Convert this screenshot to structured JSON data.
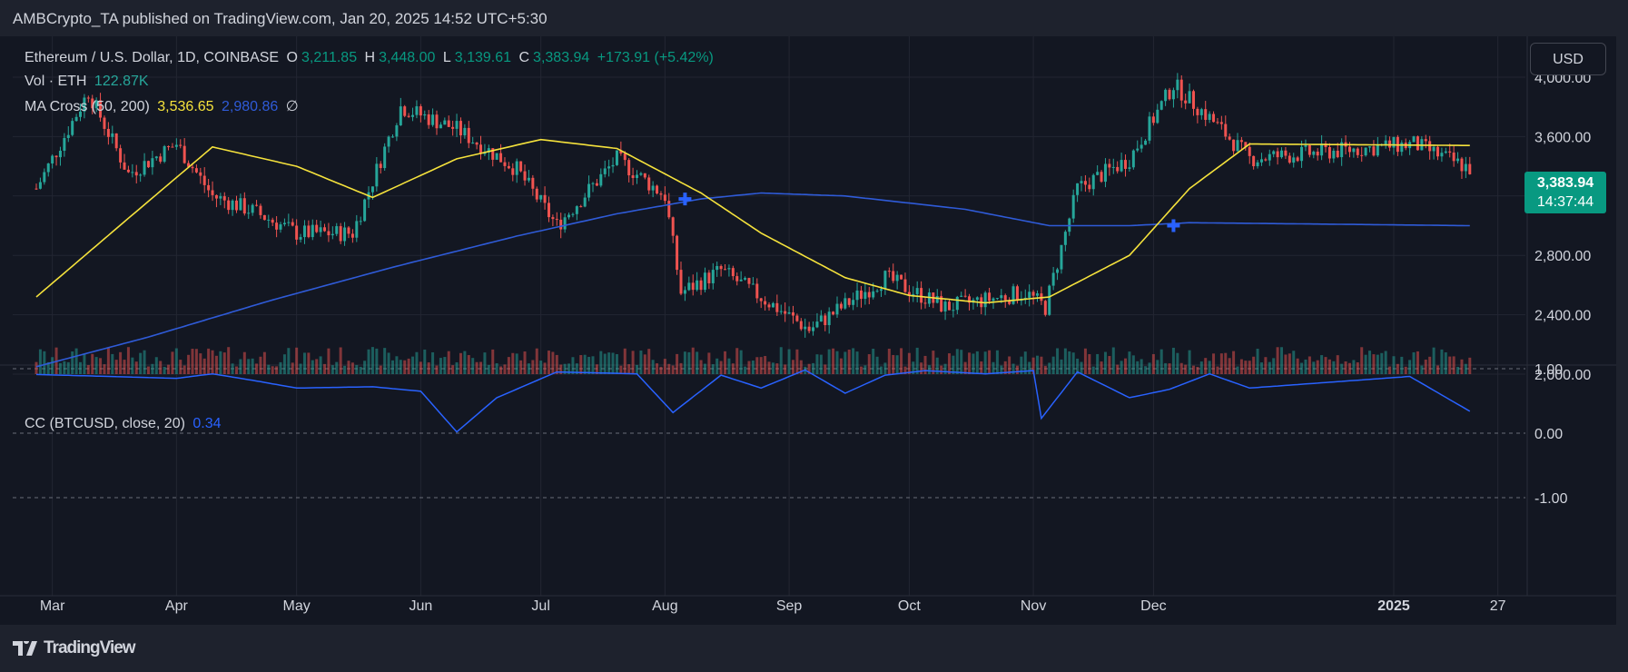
{
  "header": {
    "publisher_line": "AMBCrypto_TA published on TradingView.com, Jan 20, 2025 14:52 UTC+5:30"
  },
  "legend": {
    "symbol": "Ethereum / U.S. Dollar, 1D, COINBASE",
    "o_label": "O",
    "o_value": "3,211.85",
    "h_label": "H",
    "h_value": "3,448.00",
    "l_label": "L",
    "l_value": "3,139.61",
    "c_label": "C",
    "c_value": "3,383.94",
    "change": "+173.91 (+5.42%)",
    "vol_label": "Vol · ETH",
    "vol_value": "122.87K",
    "ma_label": "MA Cross (50, 200)",
    "ma_fast": "3,536.65",
    "ma_slow": "2,980.86",
    "ma_extra": "∅",
    "cc_label": "CC (BTCUSD, close, 20)",
    "cc_value": "0.34"
  },
  "currency_button": "USD",
  "last_price": {
    "price": "3,383.94",
    "countdown": "14:37:44"
  },
  "footer": {
    "brand": "TradingView"
  },
  "colors": {
    "up": "#26a69a",
    "down": "#ef5350",
    "ma_fast": "#f5e23c",
    "ma_slow": "#2f5bd8",
    "cc_line": "#2962ff",
    "price_tag": "#089981"
  },
  "chart_data": {
    "type": "candlestick",
    "x_ticks": [
      "Mar",
      "Apr",
      "May",
      "Jun",
      "Jul",
      "Aug",
      "Sep",
      "Oct",
      "Nov",
      "Dec",
      "2025",
      "27"
    ],
    "price_axis": {
      "ticks": [
        "4,000.00",
        "3,600.00",
        "3,200.00",
        "2,800.00",
        "2,400.00",
        "2,000.00"
      ],
      "ylim": [
        2000,
        4000
      ]
    },
    "cc_axis": {
      "ticks": [
        "1.00",
        "0.00",
        "-1.00"
      ],
      "ylim": [
        -1,
        1
      ]
    },
    "close_series": {
      "dates": [
        "Feb 26",
        "Mar 10",
        "Mar 20",
        "Apr 01",
        "Apr 10",
        "Apr 20",
        "May 01",
        "May 15",
        "May 27",
        "Jun 10",
        "Jun 25",
        "Jul 05",
        "Jul 20",
        "Aug 01",
        "Aug 05",
        "Aug 15",
        "Sep 06",
        "Sep 25",
        "Oct 10",
        "Oct 30",
        "Nov 04",
        "Nov 12",
        "Nov 25",
        "Dec 06",
        "Dec 16",
        "Dec 25",
        "Jan 06",
        "Jan 20"
      ],
      "values": [
        3250,
        3900,
        3350,
        3550,
        3200,
        3100,
        2950,
        2950,
        3800,
        3650,
        3380,
        3000,
        3450,
        3200,
        2550,
        2700,
        2300,
        2650,
        2450,
        2550,
        2450,
        3250,
        3450,
        3950,
        3700,
        3450,
        3550,
        3384
      ]
    },
    "ma50": {
      "dates": [
        "Feb 26",
        "Mar 20",
        "Apr 10",
        "May 01",
        "May 20",
        "Jun 10",
        "Jul 01",
        "Jul 20",
        "Aug 10",
        "Aug 25",
        "Sep 15",
        "Oct 01",
        "Oct 20",
        "Nov 05",
        "Nov 25",
        "Dec 10",
        "Dec 25",
        "Jan 20"
      ],
      "values": [
        2520,
        3050,
        3530,
        3400,
        3190,
        3450,
        3580,
        3520,
        3220,
        2950,
        2650,
        2530,
        2480,
        2520,
        2800,
        3250,
        3550,
        3540
      ]
    },
    "ma200": {
      "dates": [
        "Feb 26",
        "Mar 25",
        "Apr 25",
        "May 25",
        "Jun 25",
        "Jul 20",
        "Aug 10",
        "Aug 25",
        "Sep 15",
        "Oct 15",
        "Nov 05",
        "Nov 25",
        "Dec 10",
        "Jan 20"
      ],
      "values": [
        2050,
        2250,
        2500,
        2720,
        2930,
        3080,
        3180,
        3220,
        3200,
        3110,
        3000,
        3000,
        3020,
        3000
      ]
    },
    "ma_cross_markers": [
      {
        "date": "Aug 06",
        "price": 3180
      },
      {
        "date": "Dec 06",
        "price": 3000
      }
    ],
    "cc_series": {
      "dates": [
        "Feb 26",
        "Mar 15",
        "Apr 01",
        "Apr 10",
        "Apr 20",
        "May 01",
        "May 20",
        "Jun 01",
        "Jun 10",
        "Jun 20",
        "Jul 05",
        "Jul 25",
        "Aug 03",
        "Aug 15",
        "Aug 25",
        "Sep 05",
        "Sep 15",
        "Sep 25",
        "Oct 05",
        "Oct 20",
        "Nov 01",
        "Nov 03",
        "Nov 12",
        "Nov 25",
        "Dec 05",
        "Dec 15",
        "Dec 25",
        "Jan 05",
        "Jan 20"
      ],
      "values": [
        0.91,
        0.88,
        0.85,
        0.92,
        0.82,
        0.7,
        0.72,
        0.65,
        0.02,
        0.55,
        0.95,
        0.92,
        0.32,
        0.9,
        0.7,
        0.98,
        0.62,
        0.9,
        0.97,
        0.92,
        0.97,
        0.23,
        0.95,
        0.55,
        0.68,
        0.92,
        0.7,
        0.88,
        0.34
      ]
    }
  }
}
